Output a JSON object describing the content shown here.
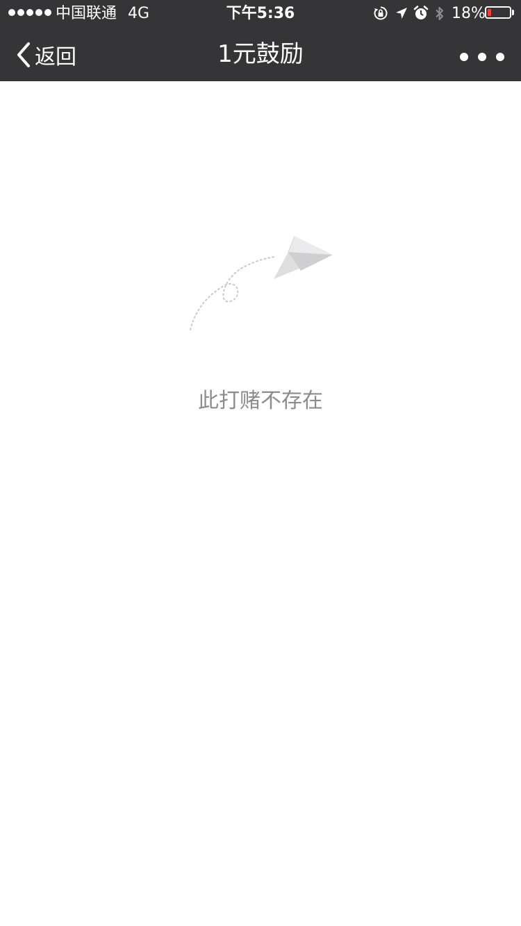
{
  "status_bar": {
    "carrier": "中国联通",
    "network": "4G",
    "time": "下午5:36",
    "battery_percent": "18%",
    "battery_level": 0.18,
    "icons": [
      "signal-dots",
      "orientation-lock-icon",
      "location-arrow-icon",
      "alarm-icon",
      "bluetooth-icon",
      "battery-icon"
    ]
  },
  "navbar": {
    "back_label": "返回",
    "title": "1元鼓励",
    "more_icon": "more-dots-icon"
  },
  "content": {
    "illustration_icon": "paper-plane-icon",
    "message": "此打赌不存在"
  },
  "colors": {
    "navbar_bg": "#353538",
    "battery_low": "#ff3b30",
    "message_text": "#8c8c8c",
    "background": "#ffffff"
  }
}
